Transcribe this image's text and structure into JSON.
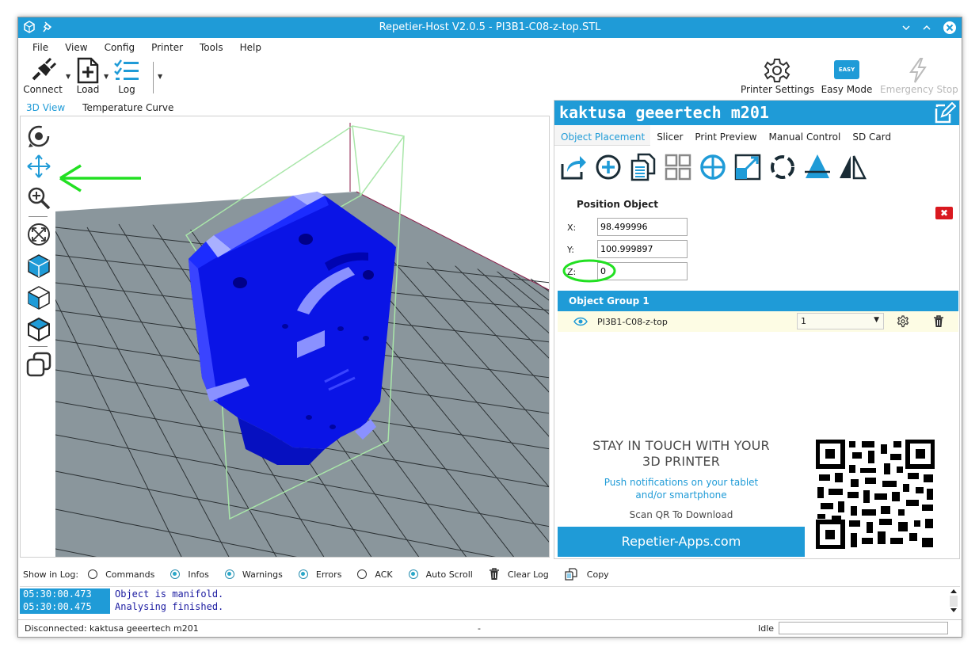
{
  "window": {
    "title": "Repetier-Host V2.0.5 - PI3B1-C08-z-top.STL"
  },
  "menu": {
    "items": [
      "File",
      "View",
      "Config",
      "Printer",
      "Tools",
      "Help"
    ]
  },
  "toolbar": {
    "connect": "Connect",
    "load": "Load",
    "log": "Log",
    "printer_settings": "Printer Settings",
    "easy_badge": "EASY",
    "easy_mode": "Easy Mode",
    "emergency_stop": "Emergency Stop"
  },
  "view_tabs": [
    "3D View",
    "Temperature Curve"
  ],
  "printer": {
    "name": "kaktusa geeertech m201"
  },
  "panel_tabs": [
    "Object Placement",
    "Slicer",
    "Print Preview",
    "Manual Control",
    "SD Card"
  ],
  "position": {
    "title": "Position Object",
    "x_label": "X:",
    "x_value": "98.499996",
    "y_label": "Y:",
    "y_value": "100.999897",
    "z_label": "Z:",
    "z_value": "0",
    "close": "✖"
  },
  "group": {
    "title": "Object Group 1",
    "object_name": "PI3B1-C08-z-top",
    "copies": "1"
  },
  "ad": {
    "line1": "STAY IN TOUCH WITH YOUR",
    "line2": "3D PRINTER",
    "line3": "Push notifications on your tablet",
    "line4": "and/or smartphone",
    "line5": "Scan QR To Download",
    "button": "Repetier-Apps.com"
  },
  "log": {
    "show_label": "Show in Log:",
    "commands": "Commands",
    "infos": "Infos",
    "warnings": "Warnings",
    "errors": "Errors",
    "ack": "ACK",
    "auto_scroll": "Auto Scroll",
    "clear_log": "Clear Log",
    "copy": "Copy",
    "lines": [
      {
        "time": "05:30:00.473",
        "msg": "Object is manifold."
      },
      {
        "time": "05:30:00.475",
        "msg": "Analysing finished."
      }
    ]
  },
  "status": {
    "connection": "Disconnected: kaktusa geeertech m201",
    "middle": "-",
    "state": "Idle"
  },
  "colors": {
    "accent": "#1f9bd7",
    "model": "#0a14e6",
    "annotation": "#22e022"
  }
}
